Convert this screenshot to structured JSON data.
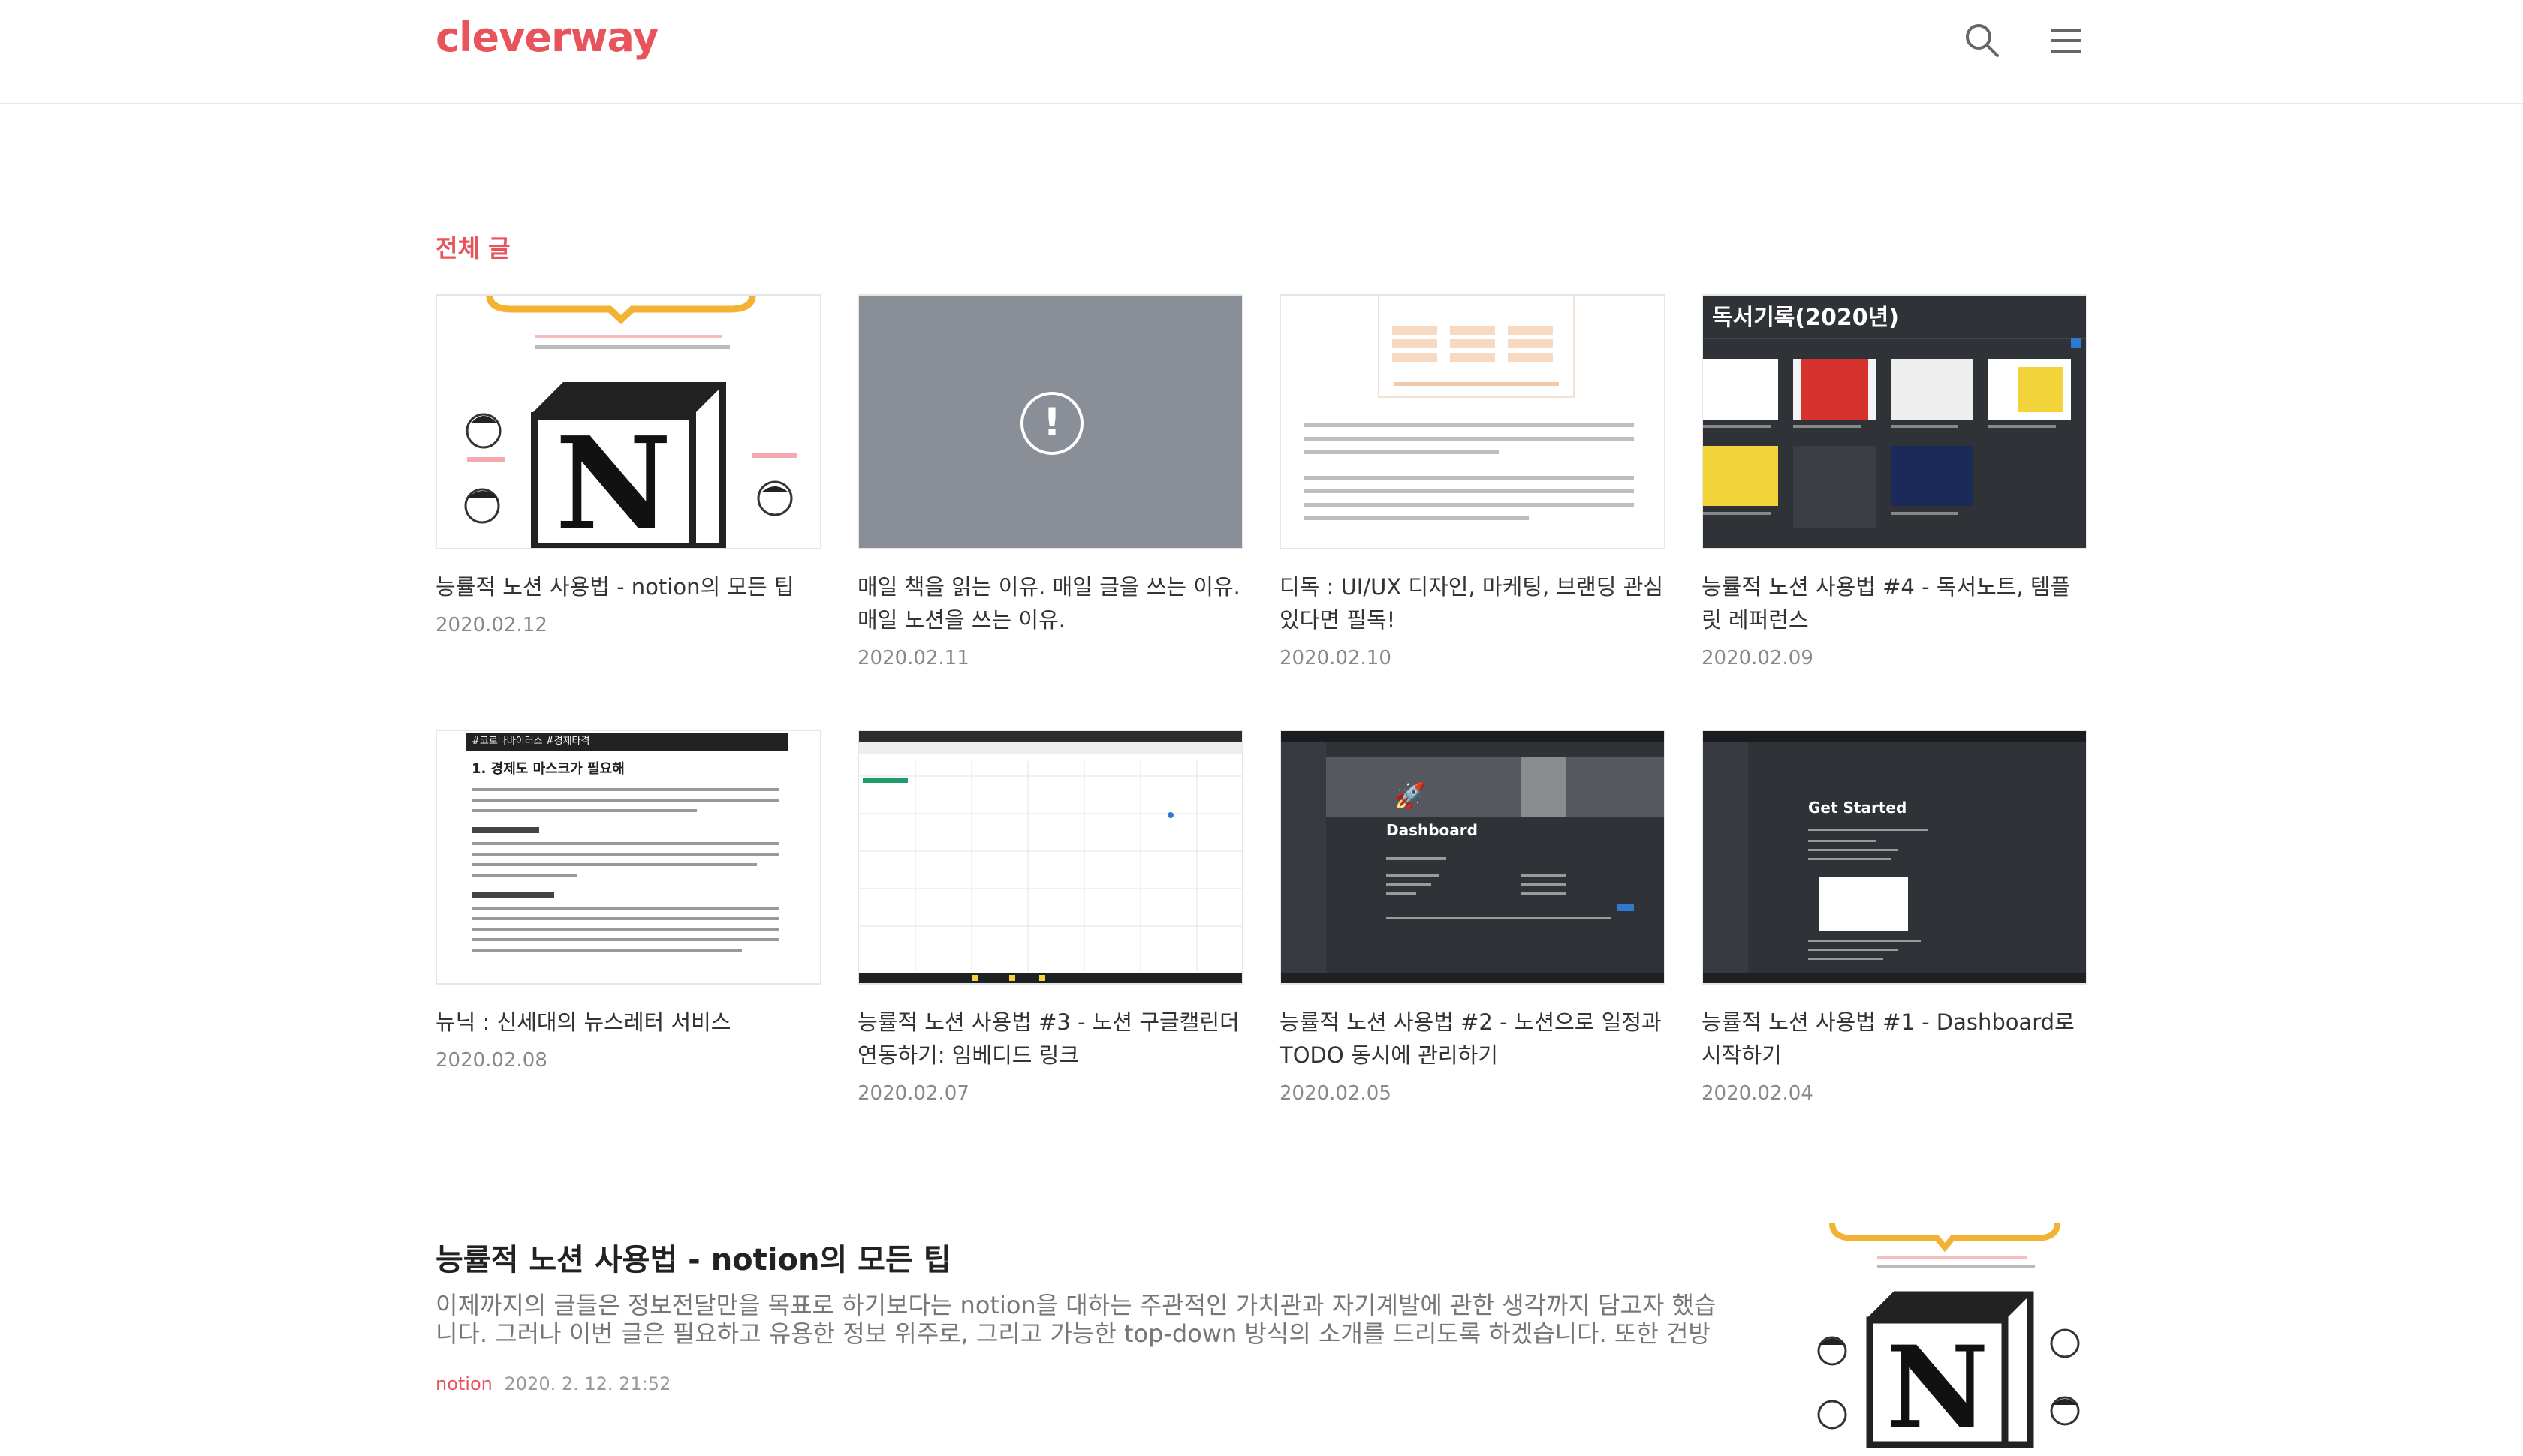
{
  "site": {
    "logo": "cleverway"
  },
  "header": {
    "search_icon": "search-icon",
    "menu_icon": "hamburger-menu-icon"
  },
  "section": {
    "title": "전체 글"
  },
  "posts": [
    {
      "title": "능률적 노션 사용법 - notion의 모든 팁",
      "date": "2020.02.12"
    },
    {
      "title": "매일 책을 읽는 이유. 매일 글을 쓰는 이유. 매일 노션을 쓰는 이유.",
      "date": "2020.02.11"
    },
    {
      "title": "디독 : UI/UX 디자인, 마케팅, 브랜딩 관심 있다면 필독!",
      "date": "2020.02.10"
    },
    {
      "title": "능률적 노션 사용법 #4 - 독서노트, 템플릿 레퍼런스",
      "date": "2020.02.09",
      "thumb_heading": "독서기록(2020년)"
    },
    {
      "title": "뉴닉 : 신세대의 뉴스레터 서비스",
      "date": "2020.02.08",
      "thumb_heading": "1. 경제도 마스크가 필요해",
      "thumb_tag": "#코로나바이러스 #경제타격"
    },
    {
      "title": "능률적 노션 사용법 #3 - 노션 구글캘린더 연동하기: 임베디드 링크",
      "date": "2020.02.07"
    },
    {
      "title": "능률적 노션 사용법 #2 - 노션으로 일정과 TODO 동시에 관리하기",
      "date": "2020.02.05",
      "thumb_heading": "Dashboard"
    },
    {
      "title": "능률적 노션 사용법 #1 - Dashboard로 시작하기",
      "date": "2020.02.04",
      "thumb_heading": "Get Started"
    }
  ],
  "featured": {
    "title": "능률적 노션 사용법 - notion의 모든 팁",
    "excerpt": "이제까지의 글들은 정보전달만을 목표로 하기보다는 notion을 대하는 주관적인 가치관과 자기계발에 관한 생각까지 담고자 했습니다. 그러나 이번 글은 필요하고 유용한 정보 위주로, 그리고 가능한 top-down 방식의 소개를 드리도록 하겠습니다. 또한 건방진 제…",
    "category": "notion",
    "datetime": "2020. 2. 12. 21:52"
  },
  "colors": {
    "accent": "#e8545c",
    "notion_yellow": "#f2b233"
  }
}
